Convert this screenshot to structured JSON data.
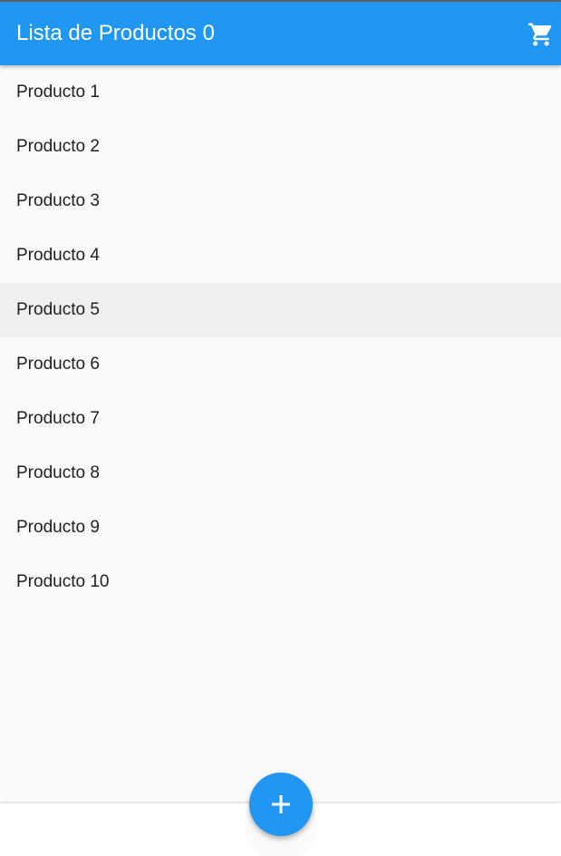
{
  "app_bar": {
    "title": "Lista de Productos 0",
    "cart_icon": "shopping-cart-icon",
    "background_color": "#2196f3",
    "text_color": "#ffffff"
  },
  "products": [
    {
      "label": "Producto 1",
      "highlighted": false
    },
    {
      "label": "Producto 2",
      "highlighted": false
    },
    {
      "label": "Producto 3",
      "highlighted": false
    },
    {
      "label": "Producto 4",
      "highlighted": false
    },
    {
      "label": "Producto 5",
      "highlighted": true
    },
    {
      "label": "Producto 6",
      "highlighted": false
    },
    {
      "label": "Producto 7",
      "highlighted": false
    },
    {
      "label": "Producto 8",
      "highlighted": false
    },
    {
      "label": "Producto 9",
      "highlighted": false
    },
    {
      "label": "Producto 10",
      "highlighted": false
    }
  ],
  "fab": {
    "icon": "plus-icon",
    "color": "#2196f3"
  },
  "colors": {
    "page_background": "#fafafa",
    "highlight_row": "#efefef",
    "bottom_bar": "#ffffff"
  }
}
